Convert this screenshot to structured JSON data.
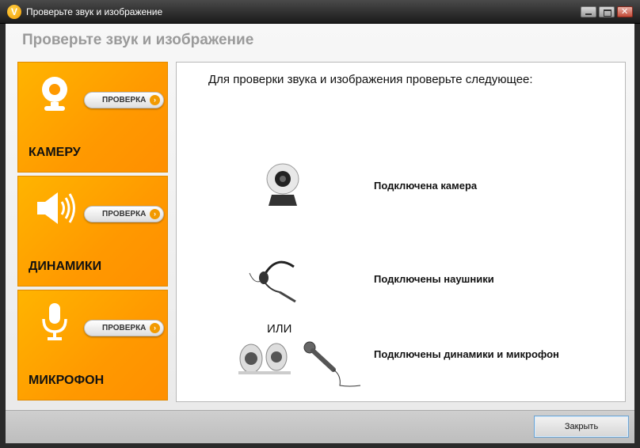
{
  "window": {
    "title": "Проверьте звук и изображение",
    "logo_letter": "V"
  },
  "header": {
    "title": "Проверьте звук и изображение"
  },
  "tiles": [
    {
      "label": "КАМЕРУ",
      "button": "ПРОВЕРКА",
      "icon": "webcam-icon"
    },
    {
      "label": "ДИНАМИКИ",
      "button": "ПРОВЕРКА",
      "icon": "speaker-icon"
    },
    {
      "label": "МИКРОФОН",
      "button": "ПРОВЕРКА",
      "icon": "microphone-icon"
    }
  ],
  "content": {
    "instructions": "Для проверки звука и изображения проверьте следующее:",
    "requirements": [
      "Подключена камера",
      "Подключены наушники",
      "Подключены динамики и микрофон"
    ],
    "or_text": "ИЛИ"
  },
  "footer": {
    "close_label": "Закрыть"
  },
  "colors": {
    "accent_orange": "#ff9900",
    "titlebar": "#1b1b1b"
  }
}
